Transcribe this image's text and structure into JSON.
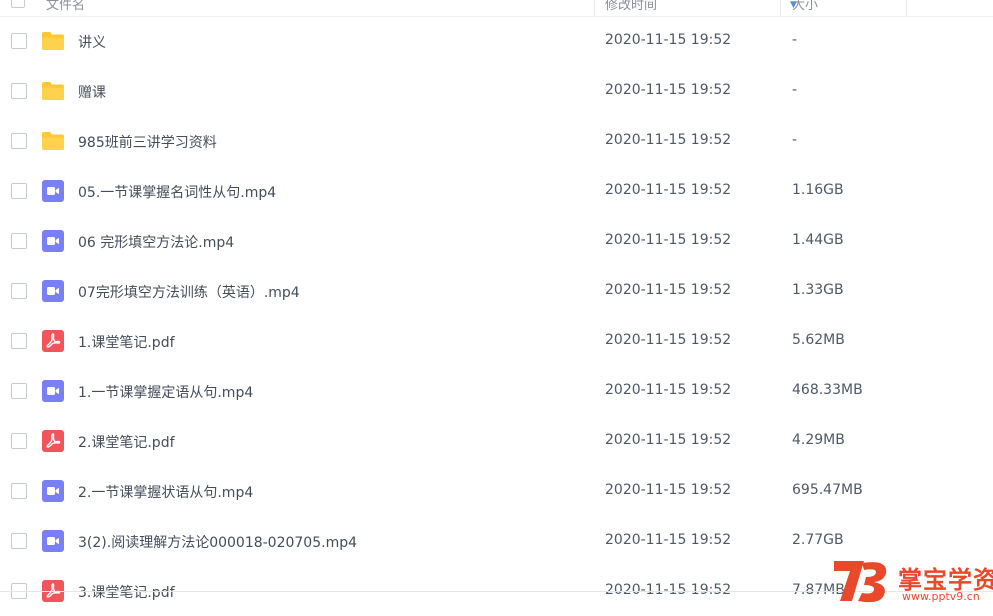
{
  "header": {
    "name": "文件名",
    "time": "修改时间",
    "size": "大小"
  },
  "files": [
    {
      "type": "folder",
      "name": "讲义",
      "time": "2020-11-15 19:52",
      "size": "-"
    },
    {
      "type": "folder",
      "name": "赠课",
      "time": "2020-11-15 19:52",
      "size": "-"
    },
    {
      "type": "folder",
      "name": "985班前三讲学习资料",
      "time": "2020-11-15 19:52",
      "size": "-"
    },
    {
      "type": "video",
      "name": "05.一节课掌握名词性从句.mp4",
      "time": "2020-11-15 19:52",
      "size": "1.16GB"
    },
    {
      "type": "video",
      "name": "06 完形填空方法论.mp4",
      "time": "2020-11-15 19:52",
      "size": "1.44GB"
    },
    {
      "type": "video",
      "name": "07完形填空方法训练（英语）.mp4",
      "time": "2020-11-15 19:52",
      "size": "1.33GB"
    },
    {
      "type": "pdf",
      "name": "1.课堂笔记.pdf",
      "time": "2020-11-15 19:52",
      "size": "5.62MB"
    },
    {
      "type": "video",
      "name": "1.一节课掌握定语从句.mp4",
      "time": "2020-11-15 19:52",
      "size": "468.33MB"
    },
    {
      "type": "pdf",
      "name": "2.课堂笔记.pdf",
      "time": "2020-11-15 19:52",
      "size": "4.29MB"
    },
    {
      "type": "video",
      "name": "2.一节课掌握状语从句.mp4",
      "time": "2020-11-15 19:52",
      "size": "695.47MB"
    },
    {
      "type": "video",
      "name": "3(2).阅读理解方法论000018-020705.mp4",
      "time": "2020-11-15 19:52",
      "size": "2.77GB"
    },
    {
      "type": "pdf",
      "name": "3.课堂笔记.pdf",
      "time": "2020-11-15 19:52",
      "size": "7.87MB"
    }
  ],
  "watermark": {
    "badge": "73",
    "text": "掌宝学资",
    "url": "www.pptv9.cn"
  },
  "colors": {
    "folder": "#ffc732",
    "video": "#7b7ff6",
    "pdf": "#f2545b",
    "sort_accent": "#4a90e2",
    "watermark": "#e8492b"
  }
}
